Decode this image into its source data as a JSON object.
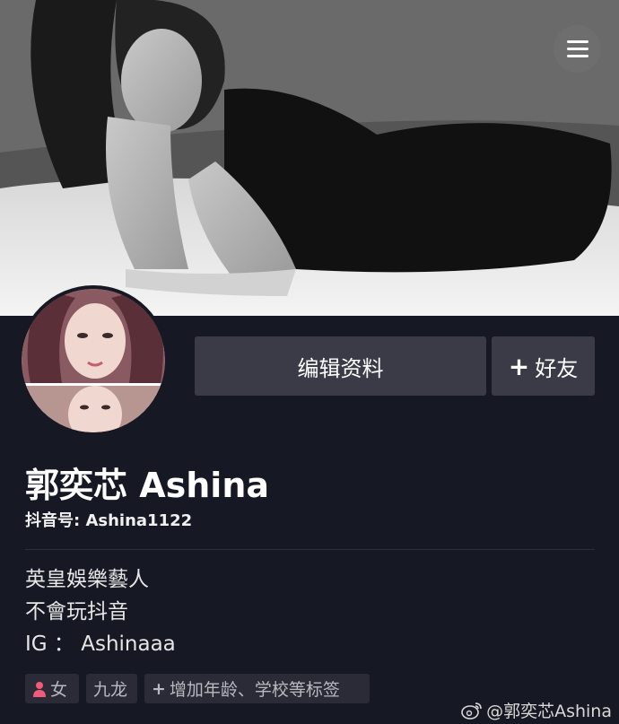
{
  "profile": {
    "name": "郭奕芯 Ashina",
    "douyin_id": "抖音号: Ashina1122",
    "bio_lines": [
      "英皇娛樂藝人",
      "不會玩抖音",
      "IG ： Ashinaaa"
    ]
  },
  "actions": {
    "edit_label": "编辑资料",
    "add_friend_label": "好友",
    "add_friend_plus": "+"
  },
  "tags": {
    "gender": "女",
    "city": "九龙",
    "add_prompt": "增加年龄、学校等标签"
  },
  "watermark": "@郭奕芯Ashina",
  "icons": {
    "menu": "hamburger-menu-icon",
    "gender": "female-icon",
    "add": "plus-icon",
    "weibo": "weibo-logo-icon"
  },
  "colors": {
    "background": "#161823",
    "button": "#3a3b46",
    "tag": "#2a2b36",
    "female": "#f25a7a"
  }
}
